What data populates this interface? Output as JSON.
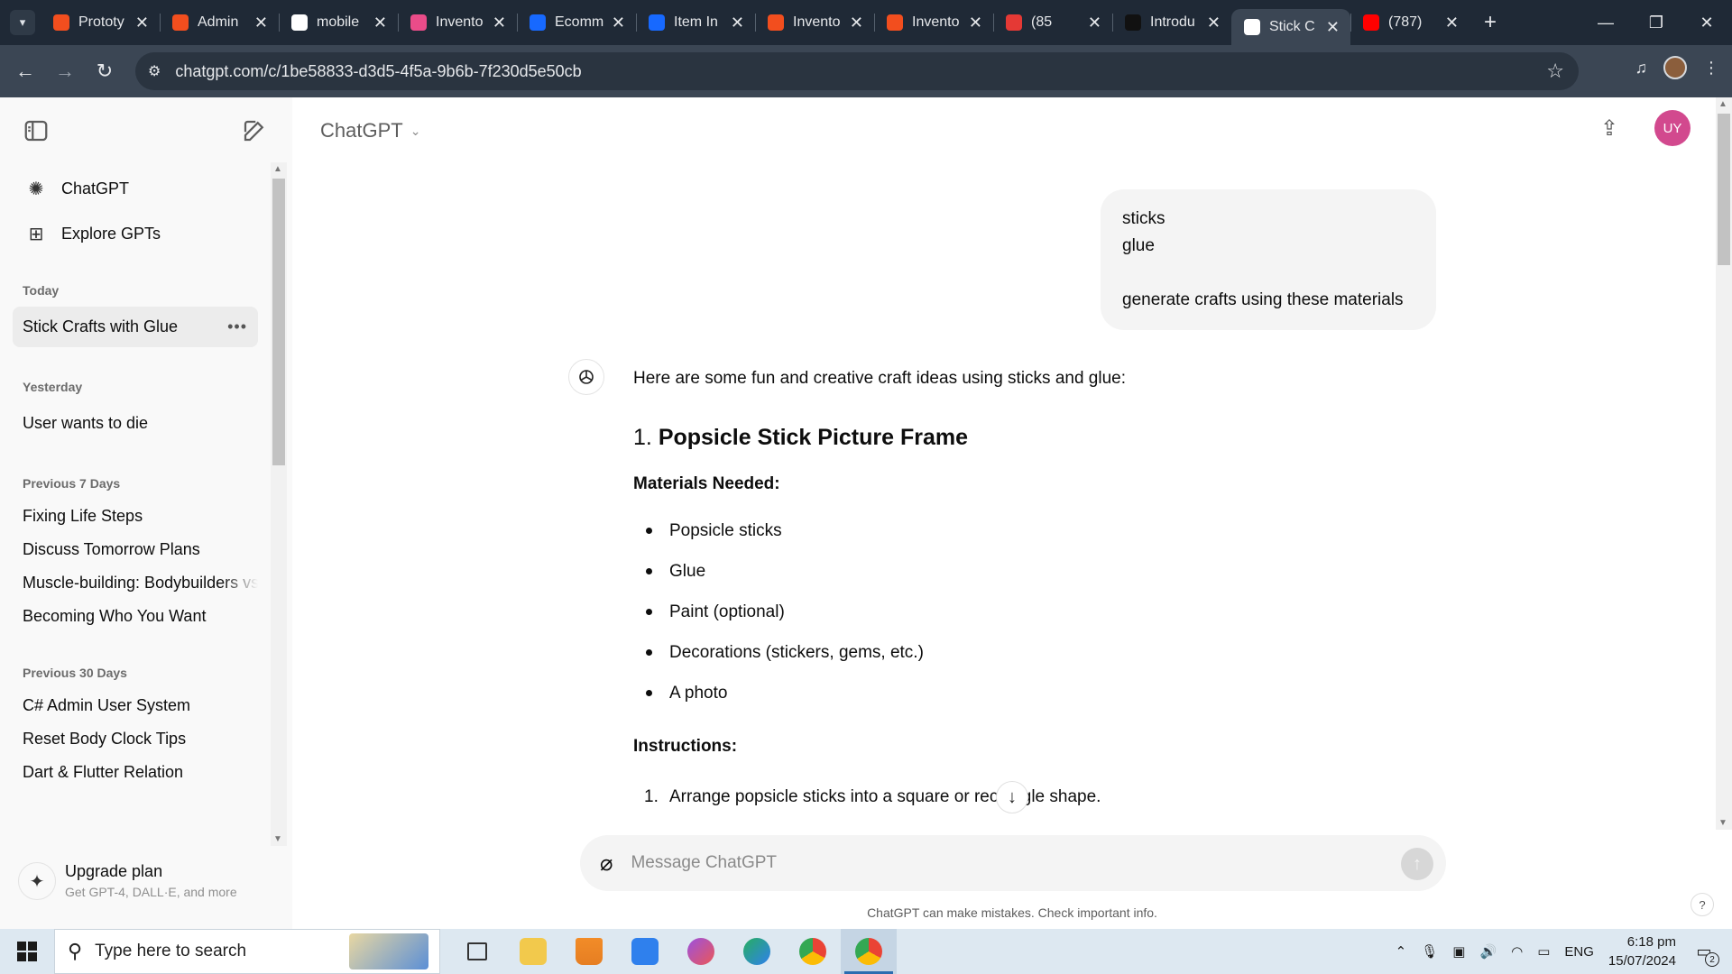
{
  "browser": {
    "tabs": [
      {
        "title": "Prototy",
        "favicon_color": "#f24e1e",
        "active": false
      },
      {
        "title": "Admin",
        "favicon_color": "#f24e1e",
        "active": false
      },
      {
        "title": "mobile",
        "favicon_color": "#ffffff",
        "active": false
      },
      {
        "title": "Invento",
        "favicon_color": "#ea4c89",
        "active": false
      },
      {
        "title": "Ecomm",
        "favicon_color": "#1769ff",
        "active": false
      },
      {
        "title": "Item In",
        "favicon_color": "#1769ff",
        "active": false
      },
      {
        "title": "Invento",
        "favicon_color": "#f24e1e",
        "active": false
      },
      {
        "title": "Invento",
        "favicon_color": "#f24e1e",
        "active": false
      },
      {
        "title": "(85",
        "favicon_color": "#e53935",
        "active": false
      },
      {
        "title": "Introdu",
        "favicon_color": "#111111",
        "active": false
      },
      {
        "title": "Stick C",
        "favicon_color": "#ffffff",
        "active": true
      },
      {
        "title": "(787)",
        "favicon_color": "#ff0000",
        "active": false
      }
    ],
    "url": "chatgpt.com/c/1be58833-d3d5-4f5a-9b6b-7f230d5e50cb"
  },
  "sidebar": {
    "links": [
      {
        "label": "ChatGPT",
        "icon": "openai-logo-icon"
      },
      {
        "label": "Explore GPTs",
        "icon": "grid-icon"
      }
    ],
    "groups": [
      {
        "heading": "Today",
        "items": [
          "Stick Crafts with Glue"
        ]
      },
      {
        "heading": "Yesterday",
        "items": [
          "User wants to die"
        ]
      },
      {
        "heading": "Previous 7 Days",
        "items": [
          "Fixing Life Steps",
          "Discuss Tomorrow Plans",
          "Muscle-building: Bodybuilders vs",
          "Becoming Who You Want"
        ]
      },
      {
        "heading": "Previous 30 Days",
        "items": [
          "C# Admin User System",
          "Reset Body Clock Tips",
          "Dart & Flutter Relation"
        ]
      }
    ],
    "active_item": "Stick Crafts with Glue",
    "upgrade": {
      "title": "Upgrade plan",
      "subtitle": "Get GPT-4, DALL·E, and more"
    }
  },
  "header": {
    "model": "ChatGPT",
    "avatar_initials": "UY",
    "avatar_color": "#d2498e"
  },
  "conversation": {
    "user_message": {
      "line1": "sticks",
      "line2": "glue",
      "line3": "generate crafts using these materials"
    },
    "assistant": {
      "intro": "Here are some fun and creative craft ideas using sticks and glue:",
      "section_number": "1.",
      "section_title": "Popsicle Stick Picture Frame",
      "materials_label": "Materials Needed:",
      "materials": [
        "Popsicle sticks",
        "Glue",
        "Paint (optional)",
        "Decorations (stickers, gems, etc.)",
        "A photo"
      ],
      "instructions_label": "Instructions:",
      "steps": [
        {
          "num": "1.",
          "text": "Arrange popsicle sticks into a square or rectangle shape."
        }
      ]
    }
  },
  "composer": {
    "placeholder": "Message ChatGPT",
    "disclaimer": "ChatGPT can make mistakes. Check important info."
  },
  "taskbar": {
    "search_placeholder": "Type here to search",
    "language": "ENG",
    "time": "6:18 pm",
    "date": "15/07/2024",
    "notification_count": "2"
  }
}
